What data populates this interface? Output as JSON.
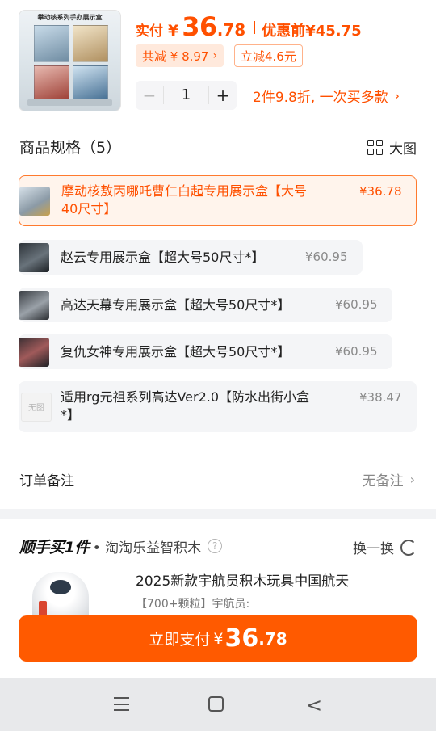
{
  "header": {
    "thumb_caption": "攀动核系列手办展示盒",
    "paid_label": "实付",
    "currency": "¥",
    "price_int": "36",
    "price_dec": ".78",
    "before_discount": "优惠前¥45.75",
    "total_discount": "共减 ¥ 8.97",
    "instant_discount": "立减4.6元",
    "quantity": "1",
    "minus": "−",
    "plus": "+",
    "multi_promo": "2件9.8折, 一次买多款"
  },
  "spec": {
    "title": "商品规格（5）",
    "big_view": "大图",
    "options": [
      {
        "line1": "摩动核敖丙哪吒曹仁白起专用展示盒【大号",
        "line2": "40尺寸】",
        "price": "¥36.78",
        "selected": true
      },
      {
        "line1": "赵云专用展示盒【超大号50尺寸*】",
        "line2": "",
        "price": "¥60.95",
        "selected": false
      },
      {
        "line1": "高达天幕专用展示盒【超大号50尺寸*】",
        "line2": "",
        "price": "¥60.95",
        "selected": false
      },
      {
        "line1": "复仇女神专用展示盒【超大号50尺寸*】",
        "line2": "",
        "price": "¥60.95",
        "selected": false
      },
      {
        "line1": "适用rg元祖系列高达Ver2.0【防水出街小盒",
        "line2": "*】",
        "price": "¥38.47",
        "selected": false,
        "no_image_label": "无图"
      }
    ]
  },
  "remark": {
    "label": "订单备注",
    "value": "无备注"
  },
  "recommend": {
    "logo": "顺手买1件",
    "shop": "• 淘淘乐益智积木",
    "help": "?",
    "swap": "换一换",
    "title": "2025新款宇航员积木玩具中国航天",
    "subtitle": "【700+颗粒】宇航员:"
  },
  "pay": {
    "label": "立即支付",
    "currency": "¥",
    "price_int": "36",
    "price_dec": ".78"
  },
  "colors": {
    "accent": "#ff5000",
    "pay_button": "#ff5a00",
    "selected_border": "#ff7a2e",
    "option_bg": "#f4f5f7"
  }
}
